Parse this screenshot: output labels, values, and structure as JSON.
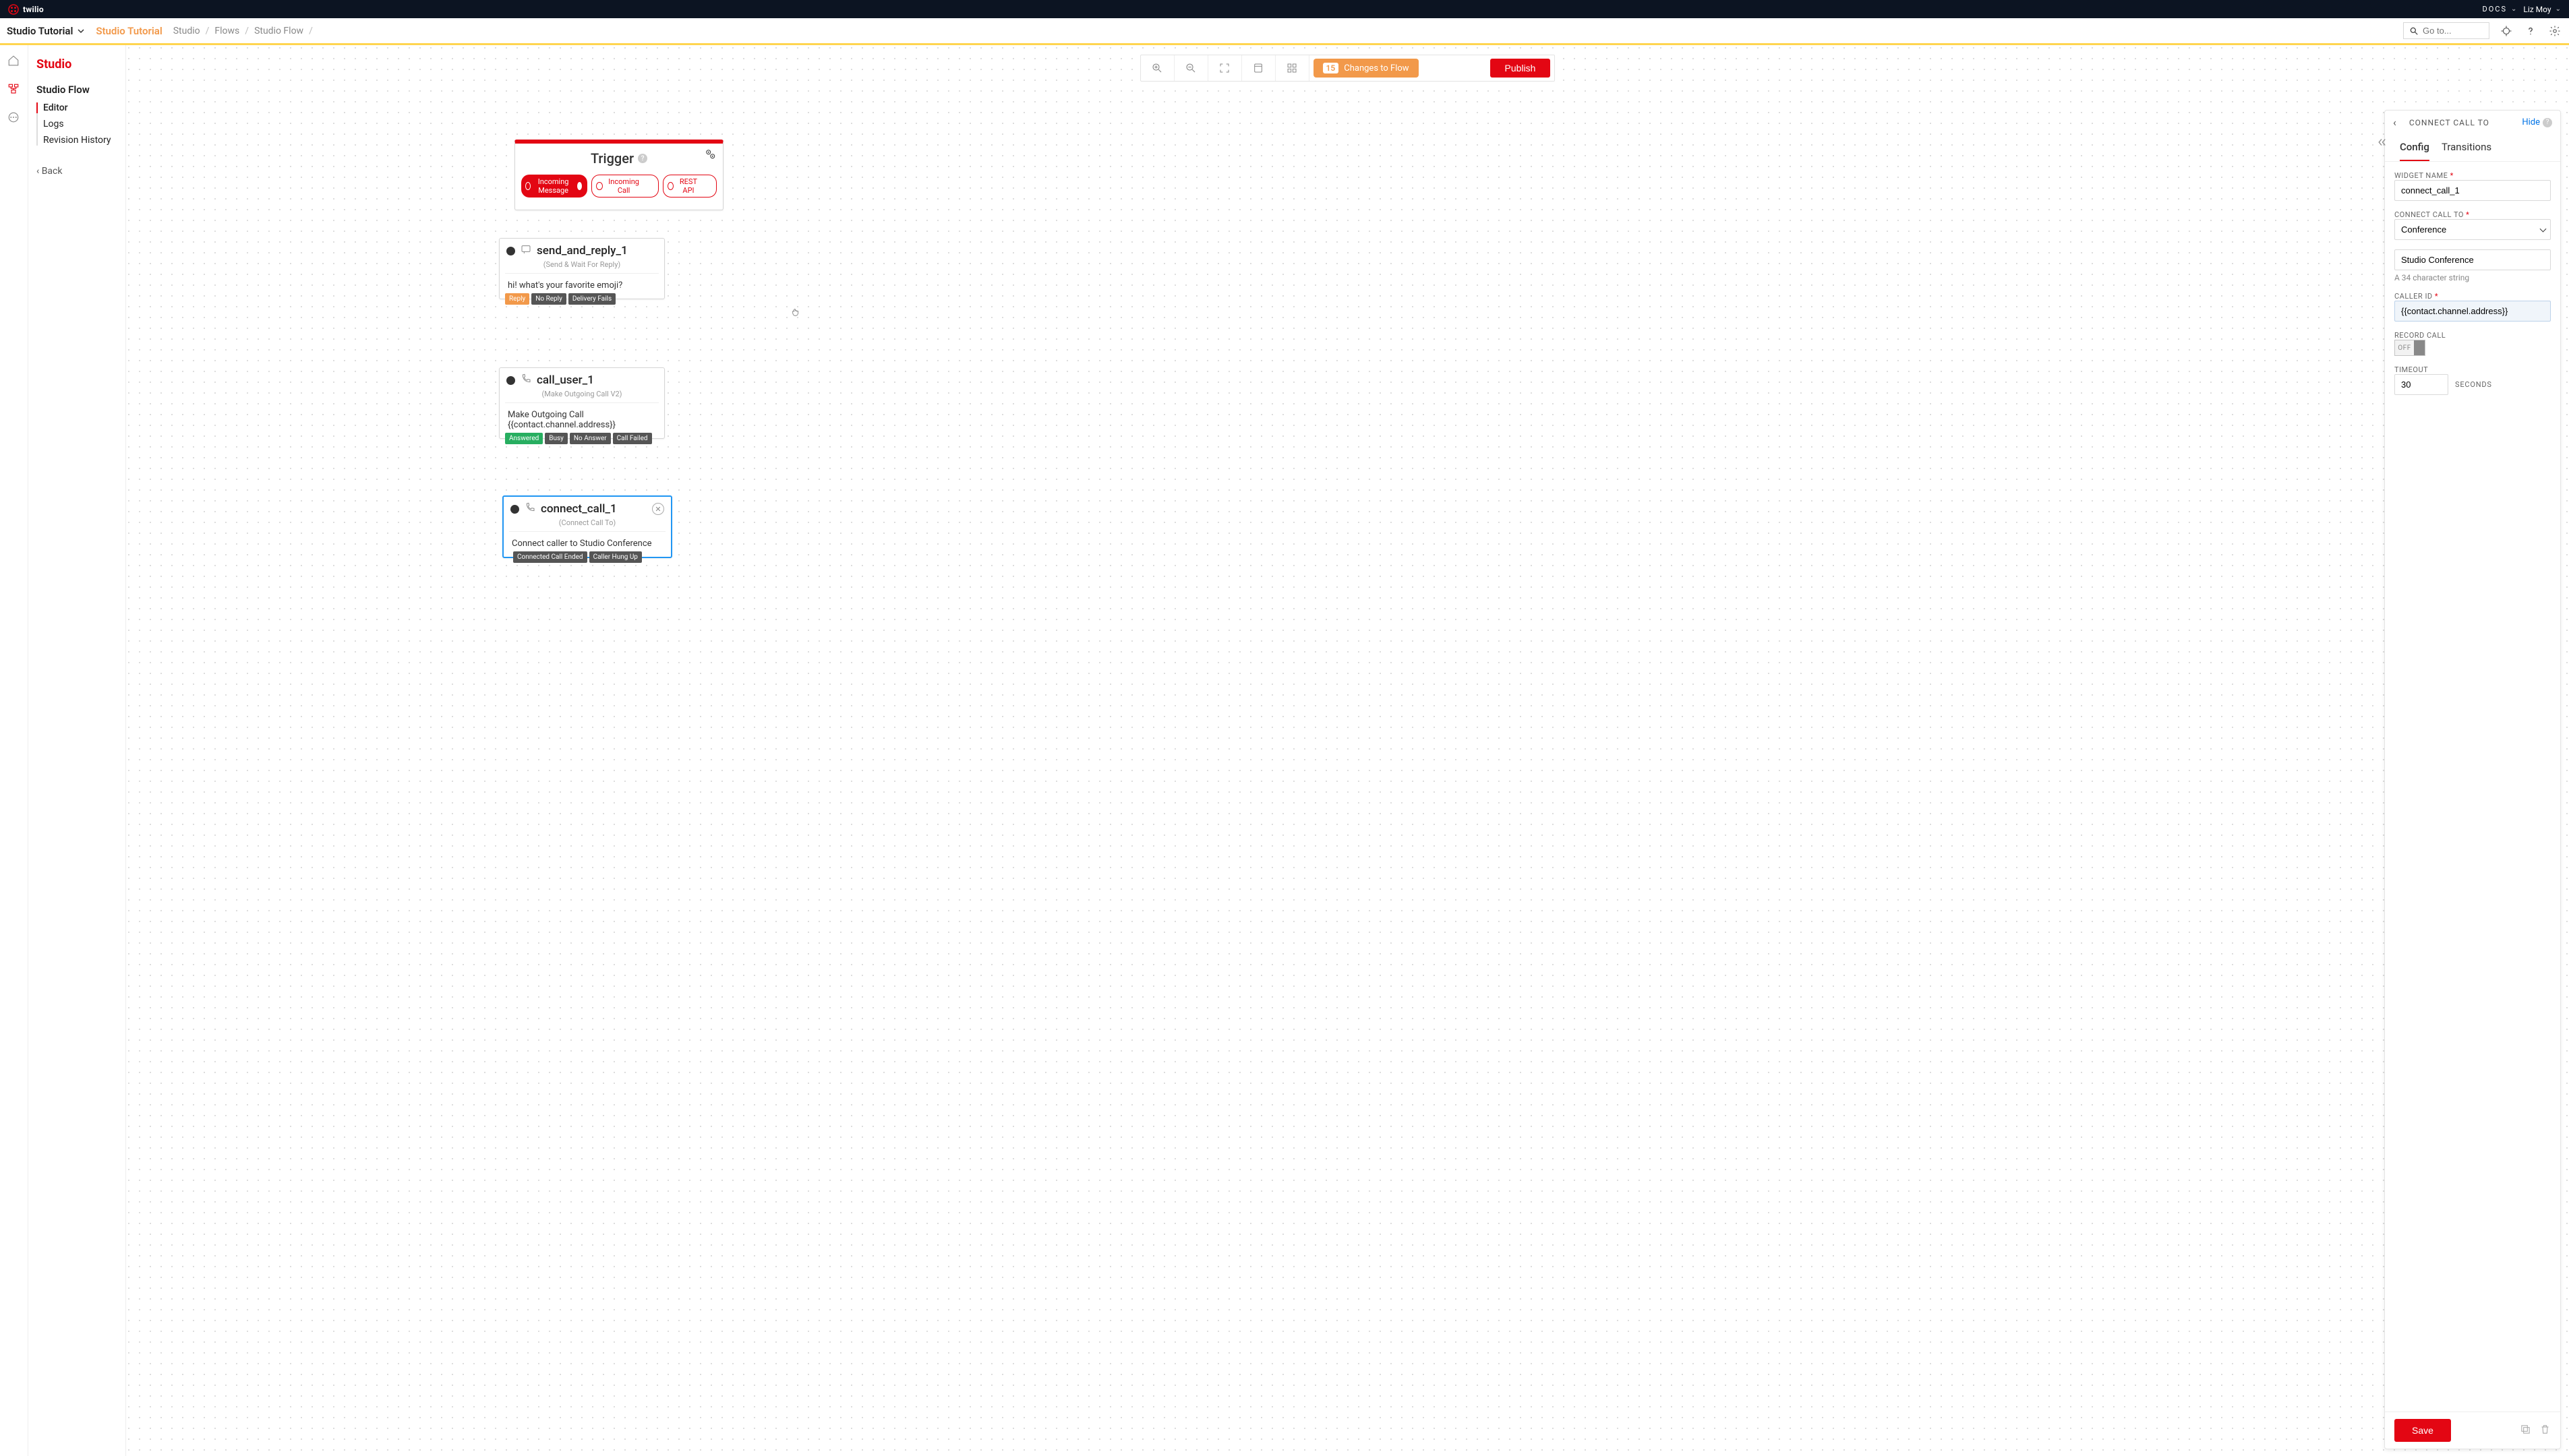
{
  "global": {
    "brand": "twilio",
    "docs": "DOCS",
    "user": "Liz Moy"
  },
  "appbar": {
    "title": "Studio Tutorial",
    "subtitle": "Studio Tutorial",
    "crumbs": [
      "Studio",
      "Flows",
      "Studio Flow"
    ],
    "search_placeholder": "Go to..."
  },
  "sidebar": {
    "title": "Studio",
    "section": "Studio Flow",
    "items": [
      "Editor",
      "Logs",
      "Revision History"
    ],
    "back": "Back"
  },
  "toolbar": {
    "changes_count": "15",
    "changes_label": "Changes to Flow",
    "publish": "Publish"
  },
  "trigger": {
    "title": "Trigger",
    "pills": [
      "Incoming Message",
      "Incoming Call",
      "REST API"
    ]
  },
  "nodes": {
    "n1": {
      "title": "send_and_reply_1",
      "subtitle": "(Send & Wait For Reply)",
      "body": "hi! what's your favorite emoji?",
      "tags": [
        "Reply",
        "No Reply",
        "Delivery Fails"
      ]
    },
    "n2": {
      "title": "call_user_1",
      "subtitle": "(Make Outgoing Call V2)",
      "body_line1": "Make Outgoing Call",
      "body_line2": "{{contact.channel.address}}",
      "tags": [
        "Answered",
        "Busy",
        "No Answer",
        "Call Failed"
      ]
    },
    "n3": {
      "title": "connect_call_1",
      "subtitle": "(Connect Call To)",
      "body": "Connect caller to Studio Conference",
      "tags": [
        "Connected Call Ended",
        "Caller Hung Up"
      ]
    }
  },
  "panel": {
    "header": "CONNECT CALL TO",
    "hide": "Hide",
    "tabs": [
      "Config",
      "Transitions"
    ],
    "widget_name_label": "WIDGET NAME",
    "widget_name": "connect_call_1",
    "connect_to_label": "CONNECT CALL TO",
    "connect_to": "Conference",
    "conference_name": "Studio Conference",
    "conference_hint": "A 34 character string",
    "caller_id_label": "CALLER ID",
    "caller_id": "{{contact.channel.address}}",
    "record_label": "RECORD CALL",
    "record_off": "OFF",
    "timeout_label": "TIMEOUT",
    "timeout": "30",
    "seconds": "SECONDS",
    "save": "Save"
  }
}
